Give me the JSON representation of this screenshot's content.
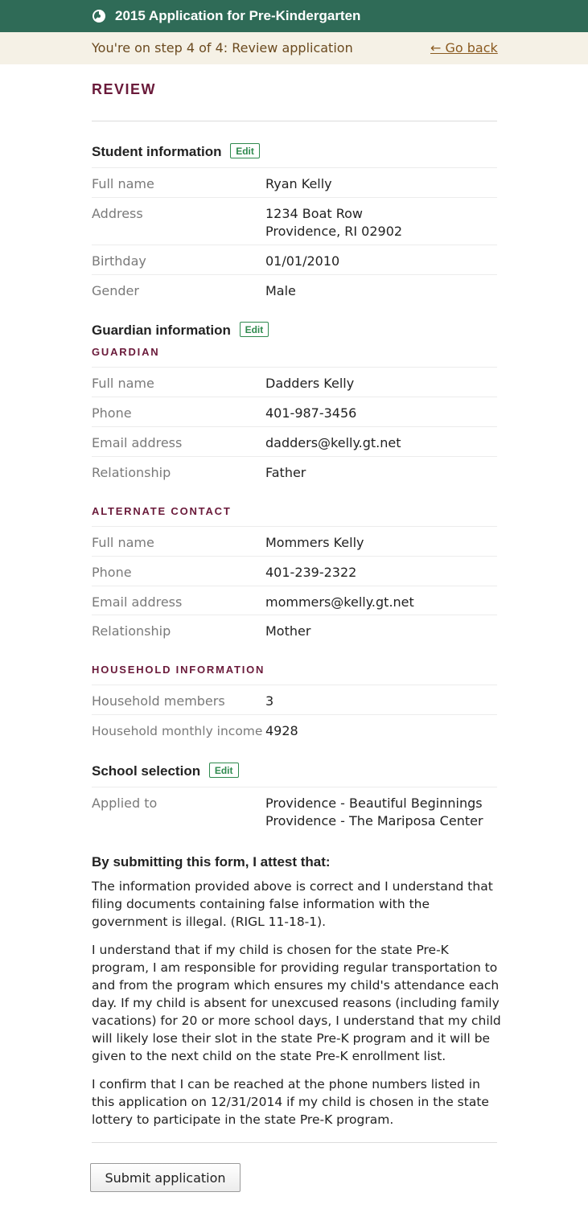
{
  "header": {
    "title": "2015 Application for Pre-Kindergarten",
    "logo_icon": "pie-logo-icon",
    "color": "#2f6b57"
  },
  "stepbar": {
    "text": "You're on step 4 of 4: Review application",
    "back_label": "← Go back"
  },
  "review_title": "REVIEW",
  "edit_label": "Edit",
  "student": {
    "title": "Student information",
    "rows": [
      {
        "label": "Full name",
        "value": "Ryan Kelly"
      },
      {
        "label": "Address",
        "value": "1234 Boat Row",
        "value2": "Providence, RI 02902"
      },
      {
        "label": "Birthday",
        "value": "01/01/2010"
      },
      {
        "label": "Gender",
        "value": "Male"
      }
    ]
  },
  "guardian": {
    "title": "Guardian information",
    "guardian_heading": "GUARDIAN",
    "guardian_rows": [
      {
        "label": "Full name",
        "value": "Dadders Kelly"
      },
      {
        "label": "Phone",
        "value": "401-987-3456"
      },
      {
        "label": "Email address",
        "value": "dadders@kelly.gt.net"
      },
      {
        "label": "Relationship",
        "value": "Father"
      }
    ],
    "alternate_heading": "ALTERNATE CONTACT",
    "alternate_rows": [
      {
        "label": "Full name",
        "value": "Mommers Kelly"
      },
      {
        "label": "Phone",
        "value": "401-239-2322"
      },
      {
        "label": "Email address",
        "value": "mommers@kelly.gt.net"
      },
      {
        "label": "Relationship",
        "value": "Mother"
      }
    ],
    "household_heading": "HOUSEHOLD INFORMATION",
    "household_rows": [
      {
        "label": "Household members",
        "value": "3"
      },
      {
        "label": "Household monthly income",
        "value": "4928"
      }
    ]
  },
  "school": {
    "title": "School selection",
    "rows": [
      {
        "label": "Applied to",
        "value": "Providence - Beautiful Beginnings",
        "value2": "Providence - The Mariposa Center"
      }
    ]
  },
  "attest": {
    "title": "By submitting this form, I attest that:",
    "p1": "The information provided above is correct and I understand that filing documents containing false information with the government is illegal. (RIGL 11-18-1).",
    "p2": "I understand that if my child is chosen for the state Pre-K program, I am responsible for providing regular transportation to and from the program which ensures my child's attendance each day. If my child is absent for unexcused reasons (including family vacations) for 20 or more school days, I understand that my child will likely lose their slot in the state Pre-K program and it will be given to the next child on the state Pre-K enrollment list.",
    "p3": "I confirm that I can be reached at the phone numbers listed in this application on 12/31/2014 if my child is chosen in the state lottery to participate in the state Pre-K program."
  },
  "submit_label": "Submit application"
}
